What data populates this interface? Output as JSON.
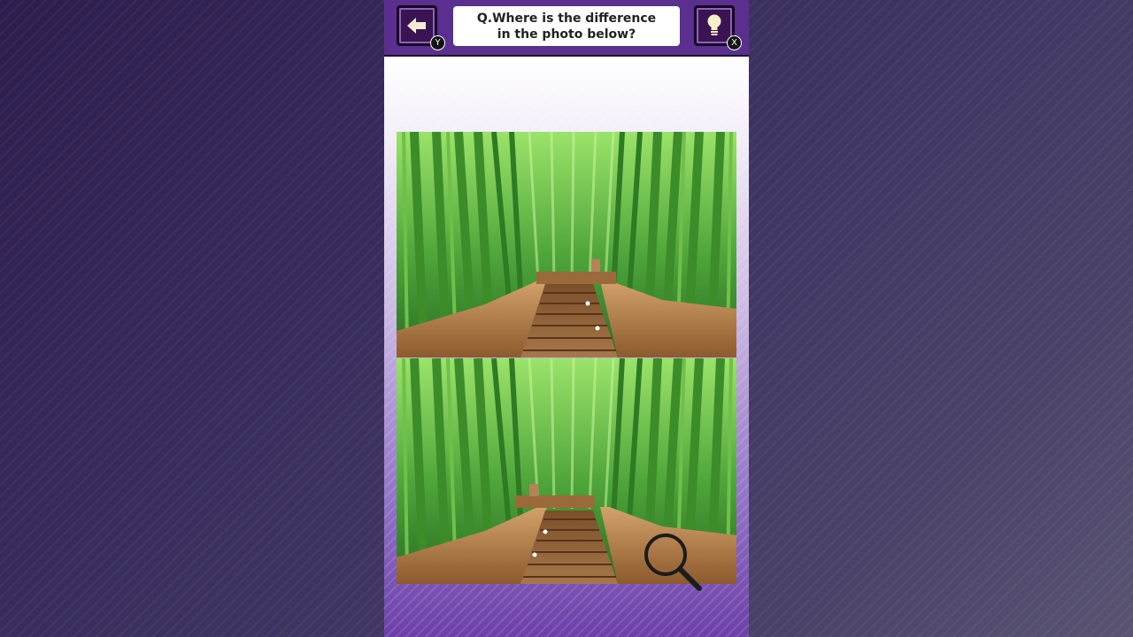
{
  "header": {
    "question_line1": "Q.Where is the difference",
    "question_line2": "in the photo below?",
    "back_key": "Y",
    "hint_key": "X"
  },
  "icons": {
    "back": "back-arrow-icon",
    "hint": "lightbulb-icon",
    "cursor": "magnifier-icon"
  },
  "colors": {
    "frame": "#5a2f8f",
    "bamboo": "#3f8f2b",
    "path": "#8a5a2f"
  }
}
